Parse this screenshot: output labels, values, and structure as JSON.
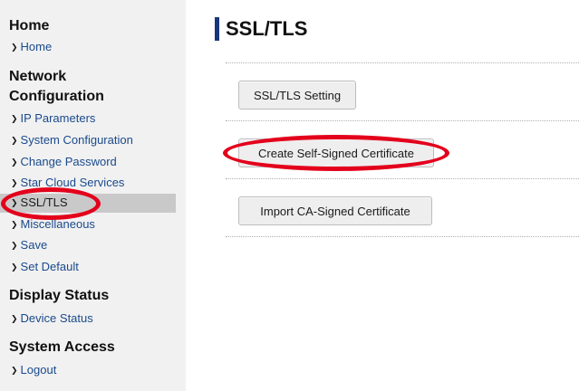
{
  "sidebar": {
    "sections": [
      {
        "title": "Home",
        "items": [
          "Home"
        ]
      },
      {
        "title": "Network Configuration",
        "items": [
          "IP Parameters",
          "System Configuration",
          "Change Password",
          "Star Cloud Services",
          "SSL/TLS",
          "Miscellaneous",
          "Save",
          "Set Default"
        ]
      },
      {
        "title": "Display Status",
        "items": [
          "Device Status"
        ]
      },
      {
        "title": "System Access",
        "items": [
          "Logout"
        ]
      }
    ],
    "active_item": "SSL/TLS"
  },
  "main": {
    "title": "SSL/TLS",
    "buttons": [
      "SSL/TLS Setting",
      "Create Self-Signed Certificate",
      "Import CA-Signed Certificate"
    ]
  },
  "colors": {
    "accent": "#17377d",
    "link": "#1a4a8c",
    "highlight_ring": "#e3001b",
    "active_bg": "#c9c9c9"
  }
}
